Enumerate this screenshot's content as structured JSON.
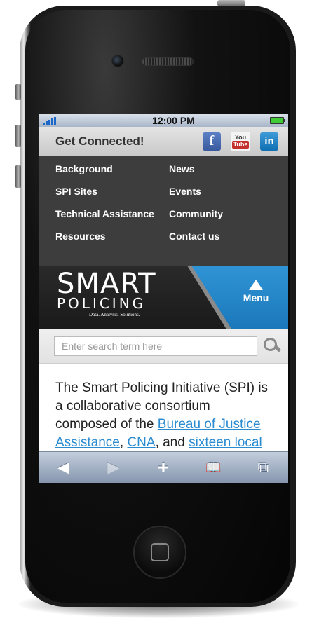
{
  "status_bar": {
    "time": "12:00 PM"
  },
  "connect": {
    "title": "Get Connected!",
    "facebook": "f",
    "youtube_you": "You",
    "youtube_tube": "Tube",
    "linkedin": "in"
  },
  "nav": {
    "items": [
      "Background",
      "News",
      "SPI Sites",
      "Events",
      "Technical Assistance",
      "Community",
      "Resources",
      "Contact us"
    ]
  },
  "banner": {
    "logo_smart": "SMART",
    "logo_policing": "POLICING",
    "tagline": "Data. Analysis. Solutions.",
    "menu_label": "Menu"
  },
  "search": {
    "placeholder": "Enter search term here"
  },
  "content": {
    "text1": "The Smart Policing Initiative (SPI) is a collaborative consortium composed of the ",
    "link1": "Bureau of Justice Assistance",
    "text2": ", ",
    "link2": "CNA",
    "text3": ", and ",
    "link3": "sixteen local"
  },
  "toolbar": {
    "back": "◀",
    "forward": "▶",
    "add": "+",
    "bookmarks": "📖",
    "pages": "⧉"
  },
  "colors": {
    "accent": "#1b78bb",
    "nav_bg": "#3d3d3d",
    "link": "#2a8bd0"
  }
}
